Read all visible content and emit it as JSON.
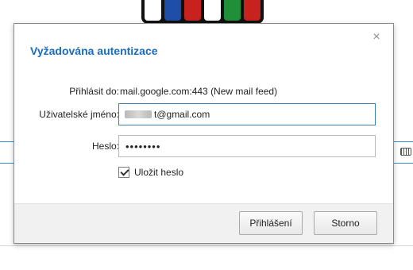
{
  "background": {
    "cube_colors": [
      "#ffffff",
      "#1e4ea8",
      "#c8221f",
      "#ffffff",
      "#1f8f3a",
      "#c8221f"
    ],
    "keyboard_icon": "keyboard-icon"
  },
  "dialog": {
    "title": "Vyžadována autentizace",
    "close_icon": "close-icon",
    "login_to_label": "Přihlásit do:",
    "login_to_value": "mail.google.com:443 (New mail feed)",
    "username_label": "Uživatelské jméno:",
    "username_value": "t@gmail.com",
    "password_label": "Heslo:",
    "password_value": "••••••••",
    "remember_label": "Uložit heslo",
    "remember_checked": true,
    "login_button": "Přihlášení",
    "cancel_button": "Storno",
    "title_color": "#1a6cbf"
  }
}
